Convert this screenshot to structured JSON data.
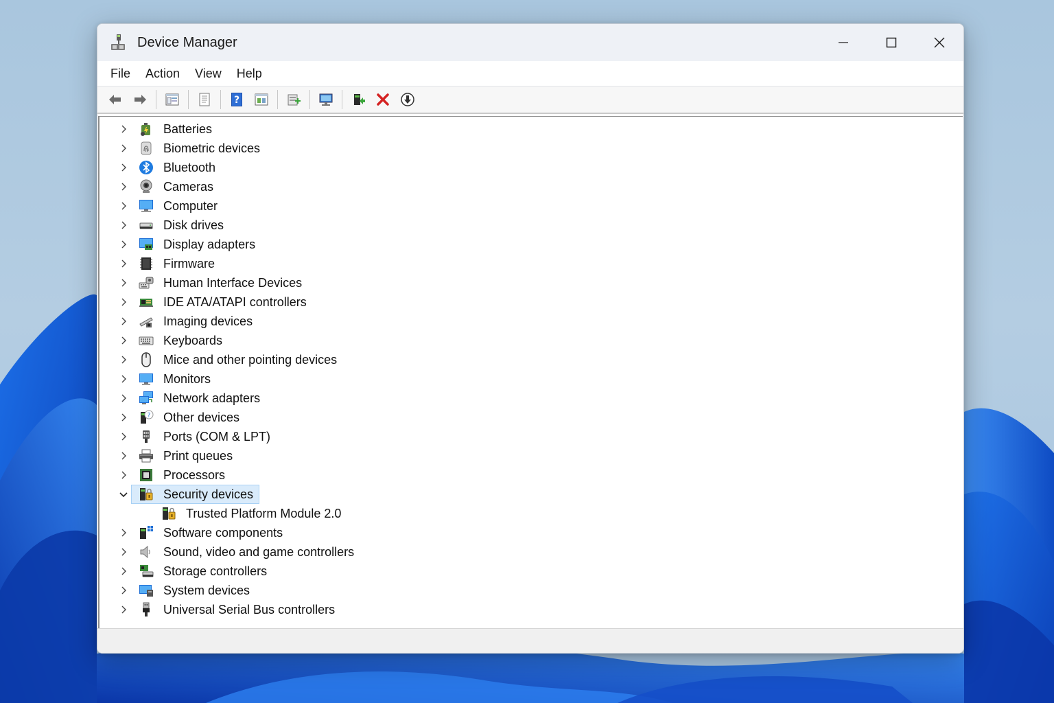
{
  "window": {
    "title": "Device Manager"
  },
  "menu": [
    "File",
    "Action",
    "View",
    "Help"
  ],
  "toolbar": [
    {
      "icon": "back-arrow-icon"
    },
    {
      "icon": "forward-arrow-icon"
    },
    {
      "sep": true
    },
    {
      "icon": "show-hide-console-tree-icon"
    },
    {
      "sep": true
    },
    {
      "icon": "properties-icon"
    },
    {
      "sep": true
    },
    {
      "icon": "help-icon"
    },
    {
      "icon": "driver-details-icon"
    },
    {
      "sep": true
    },
    {
      "icon": "update-driver-icon"
    },
    {
      "sep": true
    },
    {
      "icon": "scan-hardware-icon"
    },
    {
      "sep": true
    },
    {
      "icon": "enable-device-icon"
    },
    {
      "icon": "uninstall-device-icon"
    },
    {
      "icon": "disable-device-icon"
    }
  ],
  "tree": [
    {
      "label": "Batteries",
      "icon": "battery-icon",
      "expanded": false
    },
    {
      "label": "Biometric devices",
      "icon": "fingerprint-icon",
      "expanded": false
    },
    {
      "label": "Bluetooth",
      "icon": "bluetooth-icon",
      "expanded": false
    },
    {
      "label": "Cameras",
      "icon": "camera-icon",
      "expanded": false
    },
    {
      "label": "Computer",
      "icon": "computer-icon",
      "expanded": false
    },
    {
      "label": "Disk drives",
      "icon": "disk-drive-icon",
      "expanded": false
    },
    {
      "label": "Display adapters",
      "icon": "display-adapter-icon",
      "expanded": false
    },
    {
      "label": "Firmware",
      "icon": "firmware-chip-icon",
      "expanded": false
    },
    {
      "label": "Human Interface Devices",
      "icon": "hid-icon",
      "expanded": false
    },
    {
      "label": "IDE ATA/ATAPI controllers",
      "icon": "ide-controller-icon",
      "expanded": false
    },
    {
      "label": "Imaging devices",
      "icon": "imaging-device-icon",
      "expanded": false
    },
    {
      "label": "Keyboards",
      "icon": "keyboard-icon",
      "expanded": false
    },
    {
      "label": "Mice and other pointing devices",
      "icon": "mouse-icon",
      "expanded": false
    },
    {
      "label": "Monitors",
      "icon": "monitor-icon",
      "expanded": false
    },
    {
      "label": "Network adapters",
      "icon": "network-adapter-icon",
      "expanded": false
    },
    {
      "label": "Other devices",
      "icon": "other-device-icon",
      "expanded": false
    },
    {
      "label": "Ports (COM & LPT)",
      "icon": "port-icon",
      "expanded": false
    },
    {
      "label": "Print queues",
      "icon": "printer-icon",
      "expanded": false
    },
    {
      "label": "Processors",
      "icon": "processor-icon",
      "expanded": false
    },
    {
      "label": "Security devices",
      "icon": "security-device-icon",
      "expanded": true,
      "selected": true,
      "children": [
        {
          "label": "Trusted Platform Module 2.0",
          "icon": "tpm-icon"
        }
      ]
    },
    {
      "label": "Software components",
      "icon": "software-component-icon",
      "expanded": false
    },
    {
      "label": "Sound, video and game controllers",
      "icon": "speaker-icon",
      "expanded": false
    },
    {
      "label": "Storage controllers",
      "icon": "storage-controller-icon",
      "expanded": false
    },
    {
      "label": "System devices",
      "icon": "system-device-icon",
      "expanded": false
    },
    {
      "label": "Universal Serial Bus controllers",
      "icon": "usb-icon",
      "expanded": false
    }
  ],
  "colors": {
    "accent": "#1f6fe0",
    "selection": "#d9ebfb",
    "selection_border": "#a8d1f5"
  }
}
